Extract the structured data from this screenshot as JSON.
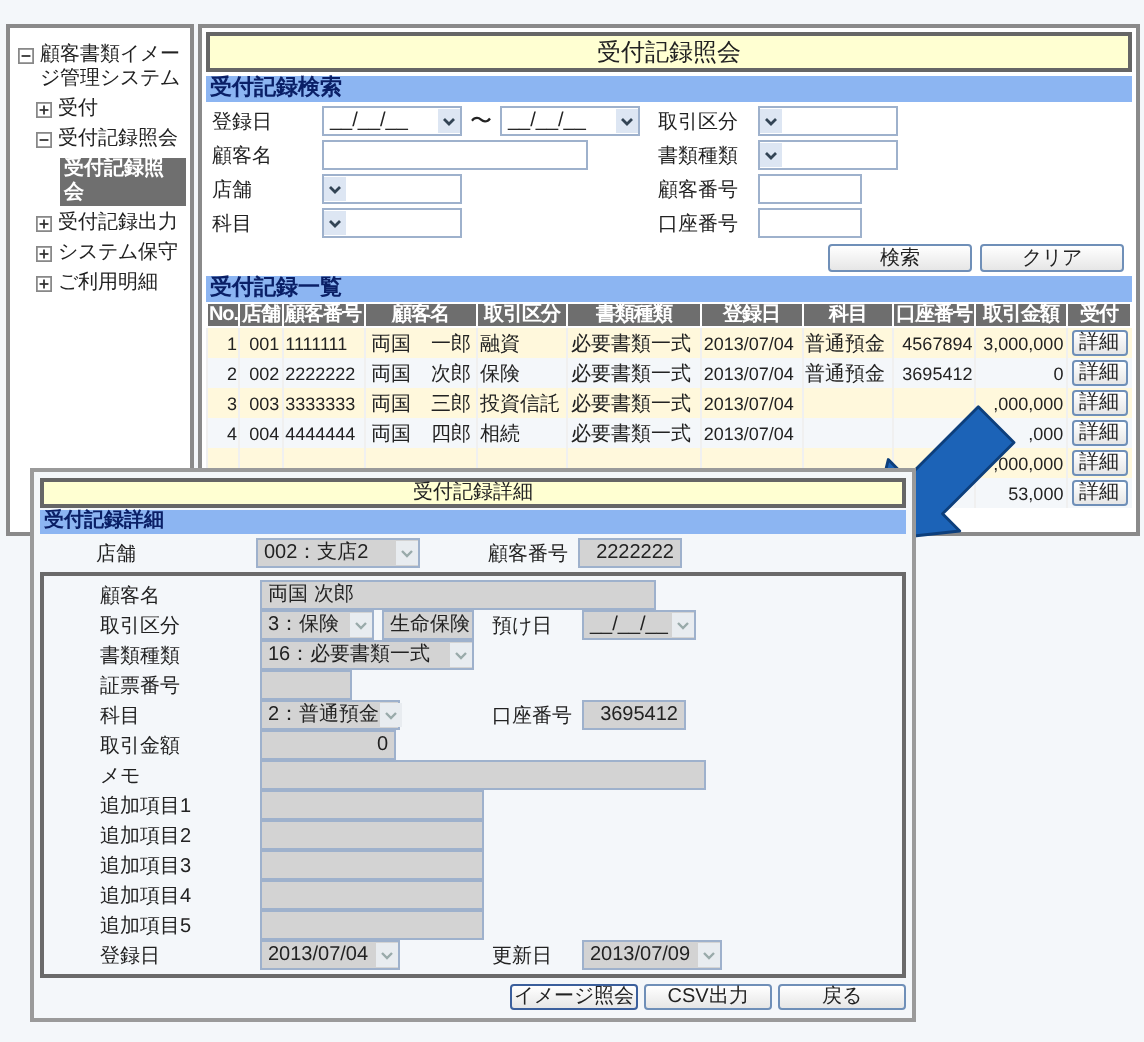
{
  "tree": {
    "label": "顧客書類イメージ管理システム",
    "expanded": true,
    "selected": false,
    "children": [
      {
        "label": "受付",
        "expanded": false,
        "selected": false
      },
      {
        "label": "受付記録照会",
        "expanded": true,
        "selected": false,
        "children": [
          {
            "label": "受付記録照会",
            "selected": true
          }
        ]
      },
      {
        "label": "受付記録出力",
        "expanded": false,
        "selected": false
      },
      {
        "label": "システム保守",
        "expanded": false,
        "selected": false
      },
      {
        "label": "ご利用明細",
        "expanded": false,
        "selected": false
      }
    ]
  },
  "page_title": "受付記録照会",
  "search": {
    "title": "受付記録検索",
    "rows": [
      {
        "left": {
          "label": "登録日",
          "kind": "date_range",
          "from": "__/__/__",
          "separator": "〜",
          "to": "__/__/__"
        },
        "right": {
          "label": "取引区分",
          "kind": "select"
        }
      },
      {
        "left": {
          "label": "顧客名",
          "kind": "text"
        },
        "right": {
          "label": "書類種類",
          "kind": "select"
        }
      },
      {
        "left": {
          "label": "店舗",
          "kind": "select"
        },
        "right": {
          "label": "顧客番号",
          "kind": "text"
        }
      },
      {
        "left": {
          "label": "科目",
          "kind": "select"
        },
        "right": {
          "label": "口座番号",
          "kind": "text"
        }
      }
    ],
    "buttons": [
      "検索",
      "クリア"
    ]
  },
  "list": {
    "title": "受付記録一覧",
    "columns": [
      "No.",
      "店舗",
      "顧客番号",
      "顧客名",
      "取引区分",
      "書類種類",
      "登録日",
      "科目",
      "口座番号",
      "取引金額",
      "受付"
    ],
    "rows": [
      {
        "cells": [
          "1",
          "001",
          "1111111",
          "両国　一郎",
          "融資",
          "必要書類一式",
          "2013/07/04",
          "普通預金",
          "4567894",
          "3,000,000"
        ],
        "button": "詳細"
      },
      {
        "cells": [
          "2",
          "002",
          "2222222",
          "両国　次郎",
          "保険",
          "必要書類一式",
          "2013/07/04",
          "普通預金",
          "3695412",
          "0"
        ],
        "button": "詳細"
      },
      {
        "cells": [
          "3",
          "003",
          "3333333",
          "両国　三郎",
          "投資信託",
          "必要書類一式",
          "2013/07/04",
          null,
          null,
          ",000,000"
        ],
        "button": "詳細"
      },
      {
        "cells": [
          "4",
          "004",
          "4444444",
          "両国　四郎",
          "相続",
          "必要書類一式",
          "2013/07/04",
          null,
          null,
          ",000"
        ],
        "button": "詳細"
      },
      {
        "cells": [
          null,
          null,
          null,
          null,
          null,
          null,
          null,
          null,
          null,
          ",000,000"
        ],
        "button": "詳細"
      },
      {
        "cells": [
          null,
          null,
          null,
          null,
          null,
          null,
          null,
          null,
          null,
          "53,000"
        ],
        "button": "詳細"
      }
    ]
  },
  "detail": {
    "title": "受付記録詳細",
    "section_title": "受付記録詳細",
    "fields_disabled": true,
    "top_rows": [
      {
        "groups": [
          {
            "label": "店舗",
            "controls": [
              {
                "kind": "select",
                "value": "002：支店2"
              }
            ]
          },
          {
            "label": "顧客番号",
            "controls": [
              {
                "kind": "number",
                "value": "2222222"
              }
            ]
          }
        ]
      }
    ],
    "rows": [
      {
        "groups": [
          {
            "label": "顧客名",
            "controls": [
              {
                "kind": "text",
                "value": "両国 次郎"
              }
            ]
          }
        ]
      },
      {
        "groups": [
          {
            "label": "取引区分",
            "controls": [
              {
                "kind": "select",
                "value": "3：保険"
              },
              {
                "kind": "text",
                "value": "生命保険"
              }
            ]
          },
          {
            "label": "預け日",
            "controls": [
              {
                "kind": "select",
                "value": "__/__/__"
              }
            ]
          }
        ]
      },
      {
        "groups": [
          {
            "label": "書類種類",
            "controls": [
              {
                "kind": "select",
                "value": "16：必要書類一式"
              }
            ]
          }
        ]
      },
      {
        "groups": [
          {
            "label": "証票番号",
            "controls": [
              {
                "kind": "text"
              }
            ]
          }
        ]
      },
      {
        "groups": [
          {
            "label": "科目",
            "controls": [
              {
                "kind": "select",
                "value": "2：普通預金"
              }
            ]
          },
          {
            "label": "口座番号",
            "controls": [
              {
                "kind": "number",
                "value": "3695412"
              }
            ]
          }
        ]
      },
      {
        "groups": [
          {
            "label": "取引金額",
            "controls": [
              {
                "kind": "number",
                "value": "0"
              }
            ]
          }
        ]
      },
      {
        "groups": [
          {
            "label": "メモ",
            "controls": [
              {
                "kind": "text"
              }
            ]
          }
        ]
      },
      {
        "groups": [
          {
            "label": "追加項目1",
            "controls": [
              {
                "kind": "text"
              }
            ]
          }
        ]
      },
      {
        "groups": [
          {
            "label": "追加項目2",
            "controls": [
              {
                "kind": "text"
              }
            ]
          }
        ]
      },
      {
        "groups": [
          {
            "label": "追加項目3",
            "controls": [
              {
                "kind": "text"
              }
            ]
          }
        ]
      },
      {
        "groups": [
          {
            "label": "追加項目4",
            "controls": [
              {
                "kind": "text"
              }
            ]
          }
        ]
      },
      {
        "groups": [
          {
            "label": "追加項目5",
            "controls": [
              {
                "kind": "text"
              }
            ]
          }
        ]
      },
      {
        "groups": [
          {
            "label": "登録日",
            "controls": [
              {
                "kind": "select",
                "value": "2013/07/04"
              }
            ]
          },
          {
            "label": "更新日",
            "controls": [
              {
                "kind": "select",
                "value": "2013/07/09"
              }
            ]
          }
        ]
      }
    ],
    "buttons": [
      "イメージ照会",
      "CSV出力",
      "戻る"
    ]
  }
}
